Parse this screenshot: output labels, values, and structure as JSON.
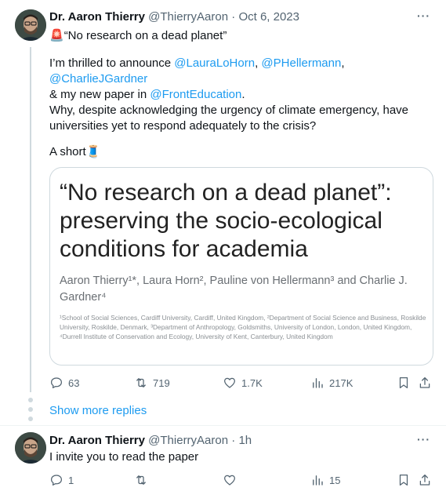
{
  "tweet1": {
    "author_name": "Dr. Aaron Thierry",
    "handle": "@ThierryAaron",
    "separator": " · ",
    "date": "Oct 6, 2023",
    "more": "···",
    "line1_emoji": "🚨",
    "line1_text": "“No research on a dead planet”",
    "p2_prefix": "I’m thrilled to announce ",
    "mention1": "@LauraLoHorn",
    "comma1": ", ",
    "mention2": "@PHellermann",
    "comma2": ", ",
    "mention3": "@CharlieJGardner",
    "p2_mid": "& my new paper in ",
    "mention4": "@FrontEducation",
    "p2_end": ".",
    "p3": "Why, despite acknowledging the urgency of climate emergency, have universities yet to respond adequately to the crisis?",
    "p4": "A short",
    "p4_emoji": "🧵",
    "card": {
      "title": "“No research on a dead planet”: preserving the socio-ecological conditions for academia",
      "authors": "Aaron Thierry¹*, Laura Horn², Pauline von Hellermann³ and Charlie J. Gardner⁴",
      "affiliations": "¹School of Social Sciences, Cardiff University, Cardiff, United Kingdom, ²Department of Social Science and Business, Roskilde University, Roskilde, Denmark, ³Department of Anthropology, Goldsmiths, University of London, London, United Kingdom, ⁴Durrell Institute of Conservation and Ecology, University of Kent, Canterbury, United Kingdom"
    },
    "replies": "63",
    "retweets": "719",
    "likes": "1.7K",
    "views": "217K"
  },
  "show_more": "Show more replies",
  "tweet2": {
    "author_name": "Dr. Aaron Thierry",
    "handle": "@ThierryAaron",
    "separator": " · ",
    "date": "1h",
    "more": "···",
    "text": "I invite you to read the paper",
    "replies": "1",
    "retweets": "",
    "likes": "",
    "views": "15"
  },
  "colors": {
    "link": "#1d9bf0",
    "secondary_text": "#536471",
    "border": "#cfd9de"
  },
  "icons": [
    "reply-icon",
    "retweet-icon",
    "like-icon",
    "views-icon",
    "bookmark-icon",
    "share-icon",
    "more-icon"
  ]
}
